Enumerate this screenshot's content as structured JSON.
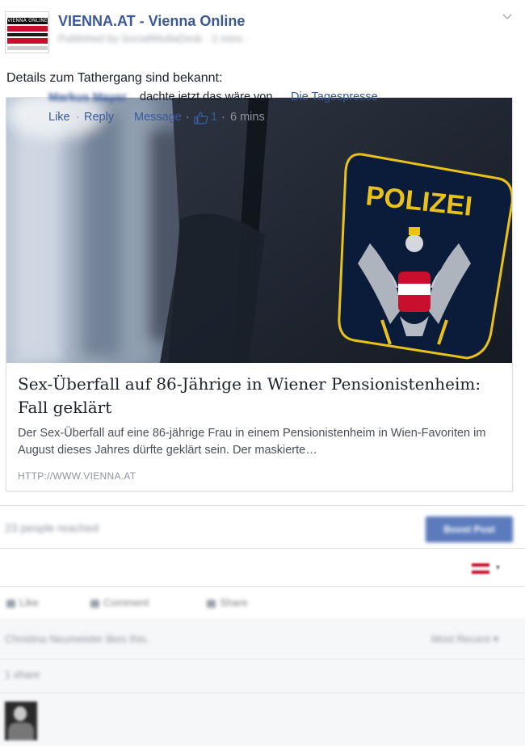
{
  "header": {
    "page_name": "VIENNA.AT - Vienna Online",
    "avatar_label": "VIENNA ONLINE",
    "post_meta": "Published by SocialMediaDesk · 2 mins ·",
    "chevron_icon": "chevron-down-icon"
  },
  "post": {
    "text": "Details zum Tathergang sind bekannt:"
  },
  "link_card": {
    "image_badge_text": "POLIZEI",
    "title": "Sex-Überfall auf 86-Jährige in Wiener Pensionistenheim: Fall geklärt",
    "description": "Der Sex-Überfall auf eine 86-jährige Frau in einem Pensionistenheim in Wien-Favoriten im August dieses Jahres dürfte geklärt sein. Der maskierte…",
    "domain": "HTTP://WWW.VIENNA.AT"
  },
  "reach": {
    "text": "23 people reached",
    "boost_label": "Boost Post"
  },
  "actions": {
    "like": "Like",
    "comment": "Comment",
    "share": "Share"
  },
  "comments_meta": {
    "seen_by": "Christina Neumeister likes this.",
    "sort": "Most Recent ▾",
    "shares": "1 share"
  },
  "comment": {
    "author": "Markus Mayer",
    "text": "dachte jetzt das wäre von",
    "link": "Die Tagespresse",
    "like": "Like",
    "reply": "Reply",
    "message": "Message",
    "likes": "1",
    "time": "6 mins",
    "dot": "·"
  },
  "colors": {
    "fb_blue": "#3b5998",
    "muted": "#90949c",
    "austria_red": "#c8102e",
    "badge_yellow": "#e8c21a"
  }
}
